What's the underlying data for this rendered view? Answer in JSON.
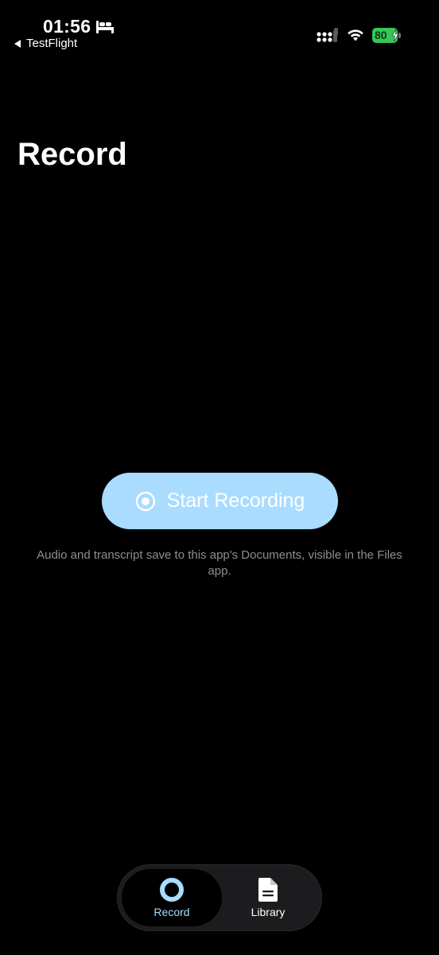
{
  "status_bar": {
    "time": "01:56",
    "back_label": "TestFlight",
    "battery_level": "80"
  },
  "page": {
    "title": "Record"
  },
  "start_button": {
    "label": "Start Recording"
  },
  "info": {
    "text": "Audio and transcript save to this app's Documents, visible in the Files app."
  },
  "tabs": [
    {
      "label": "Record",
      "icon": "record-circle-icon",
      "selected": true
    },
    {
      "label": "Library",
      "icon": "document-icon",
      "selected": false
    }
  ],
  "colors": {
    "accent": "#a9dcff",
    "background": "#000000",
    "battery": "#34c759",
    "secondary_text": "#8e8e93"
  }
}
